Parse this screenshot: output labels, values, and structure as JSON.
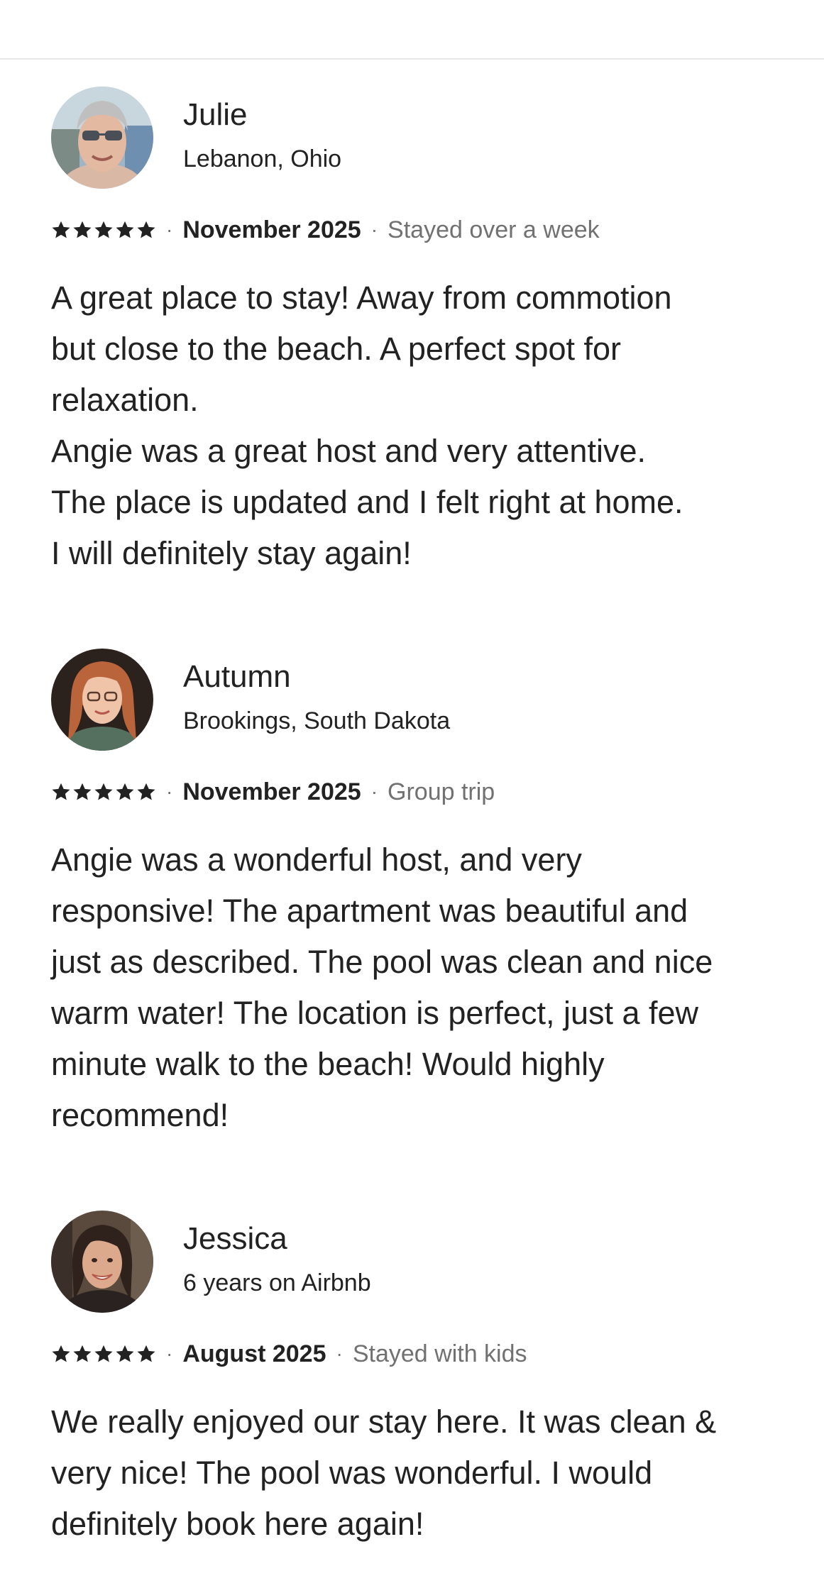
{
  "reviews": [
    {
      "name": "Julie",
      "subtitle": "Lebanon, Ohio",
      "rating": 5,
      "date": "November 2025",
      "trip_type": "Stayed over a week",
      "text": "A great place to stay! Away from commotion\nbut close to the beach. A perfect spot for\nrelaxation.\nAngie was a great host and very attentive.\nThe place is updated and I felt right at home.\nI will definitely stay again!"
    },
    {
      "name": "Autumn",
      "subtitle": "Brookings, South Dakota",
      "rating": 5,
      "date": "November 2025",
      "trip_type": "Group trip",
      "text": "Angie was a wonderful host, and very\nresponsive! The apartment was beautiful and\njust as described. The pool was clean and nice\nwarm water! The location is perfect, just a few\nminute walk to the beach! Would highly\nrecommend!"
    },
    {
      "name": "Jessica",
      "subtitle": "6 years on Airbnb",
      "rating": 5,
      "date": "August 2025",
      "trip_type": "Stayed with kids",
      "text": "We really enjoyed our stay here. It was clean &\nvery nice! The pool was wonderful. I would\ndefinitely book here again!"
    }
  ],
  "separator": "·",
  "colors": {
    "primary_text": "#222222",
    "secondary_text": "#717171",
    "divider": "#e8e8e8"
  },
  "icons": {
    "star": "star-icon",
    "avatar": "avatar-photo"
  }
}
